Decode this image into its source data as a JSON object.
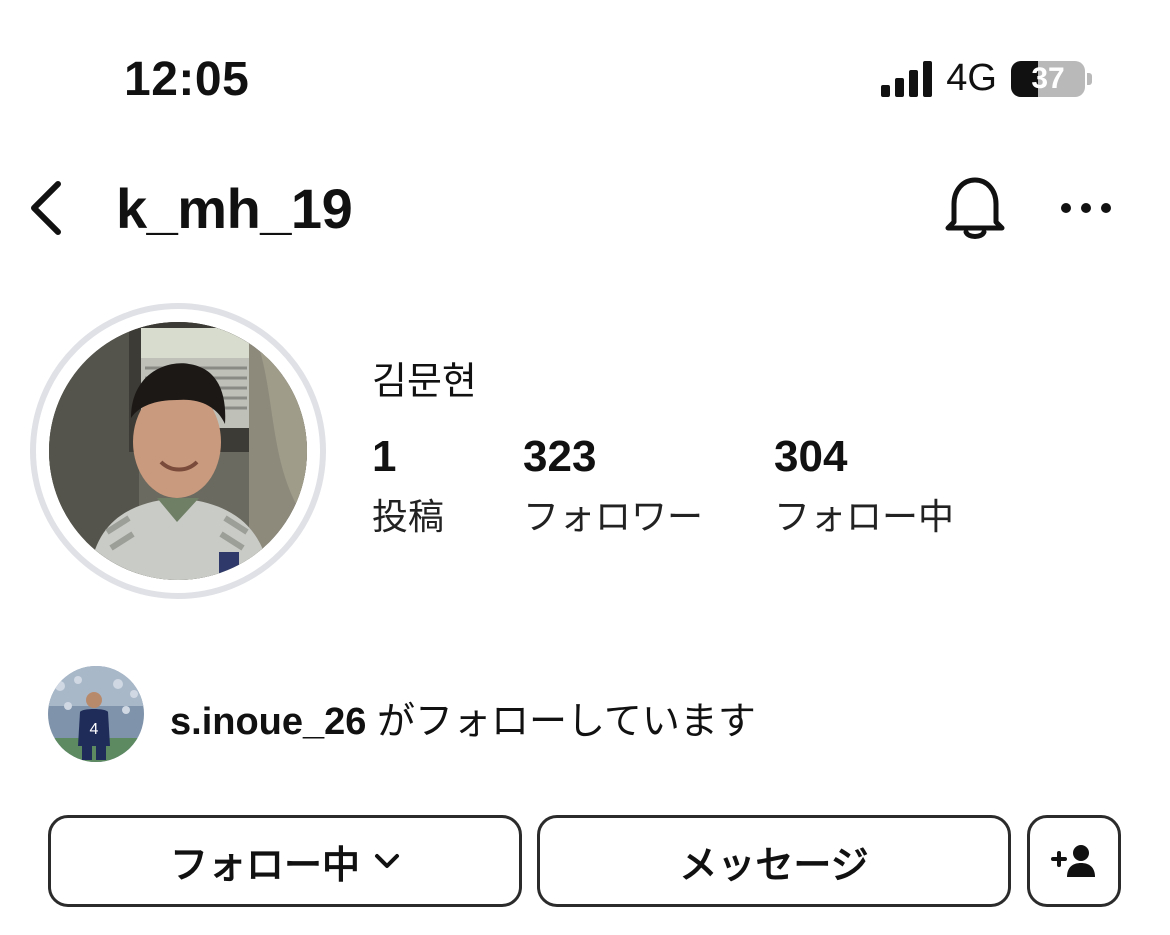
{
  "status_bar": {
    "time": "12:05",
    "network": "4G",
    "battery": "37",
    "battery_level": 0.37,
    "icons": [
      "signal-icon",
      "battery-icon"
    ]
  },
  "header": {
    "username": "k_mh_19",
    "icons": [
      "back-icon",
      "bell-icon",
      "more-icon"
    ]
  },
  "profile": {
    "display_name": "김문현",
    "stats": [
      {
        "value": "1",
        "label": "投稿"
      },
      {
        "value": "323",
        "label": "フォロワー"
      },
      {
        "value": "304",
        "label": "フォロー中"
      }
    ]
  },
  "followed_by": {
    "user": "s.inoue_26",
    "text": "がフォローしています"
  },
  "actions": {
    "following_label": "フォロー中",
    "message_label": "メッセージ",
    "icons": [
      "chevron-down-icon",
      "add-person-icon"
    ]
  }
}
